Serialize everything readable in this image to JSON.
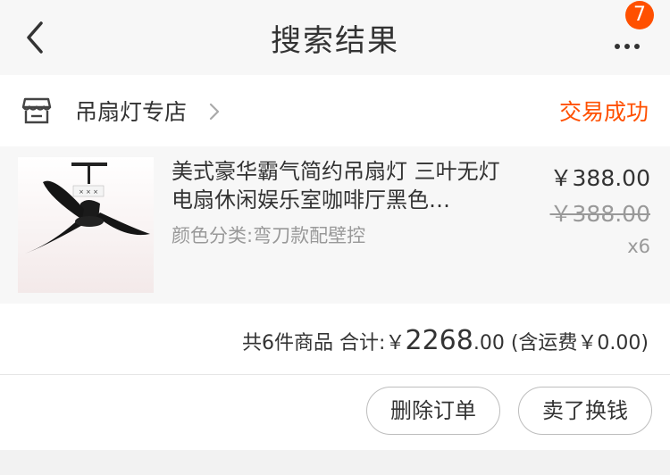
{
  "header": {
    "title": "搜索结果",
    "notification_count": "7"
  },
  "order": {
    "shop_name": "吊扇灯专店",
    "status": "交易成功",
    "status_color": "#ff5000",
    "item": {
      "title": "美式豪华霸气简约吊扇灯 三叶无灯电扇休闲娱乐室咖啡厅黑色…",
      "spec": "颜色分类:弯刀款配壁控",
      "price": "￥388.00",
      "original_price": "￥388.00",
      "quantity": "x6"
    },
    "summary": {
      "count_label": "共6件商品",
      "total_label": "合计:",
      "currency": "￥",
      "total_integer": "2268",
      "total_decimal": ".00",
      "shipping": "(含运费￥0.00)"
    },
    "actions": {
      "delete_label": "删除订单",
      "sell_label": "卖了换钱"
    }
  }
}
